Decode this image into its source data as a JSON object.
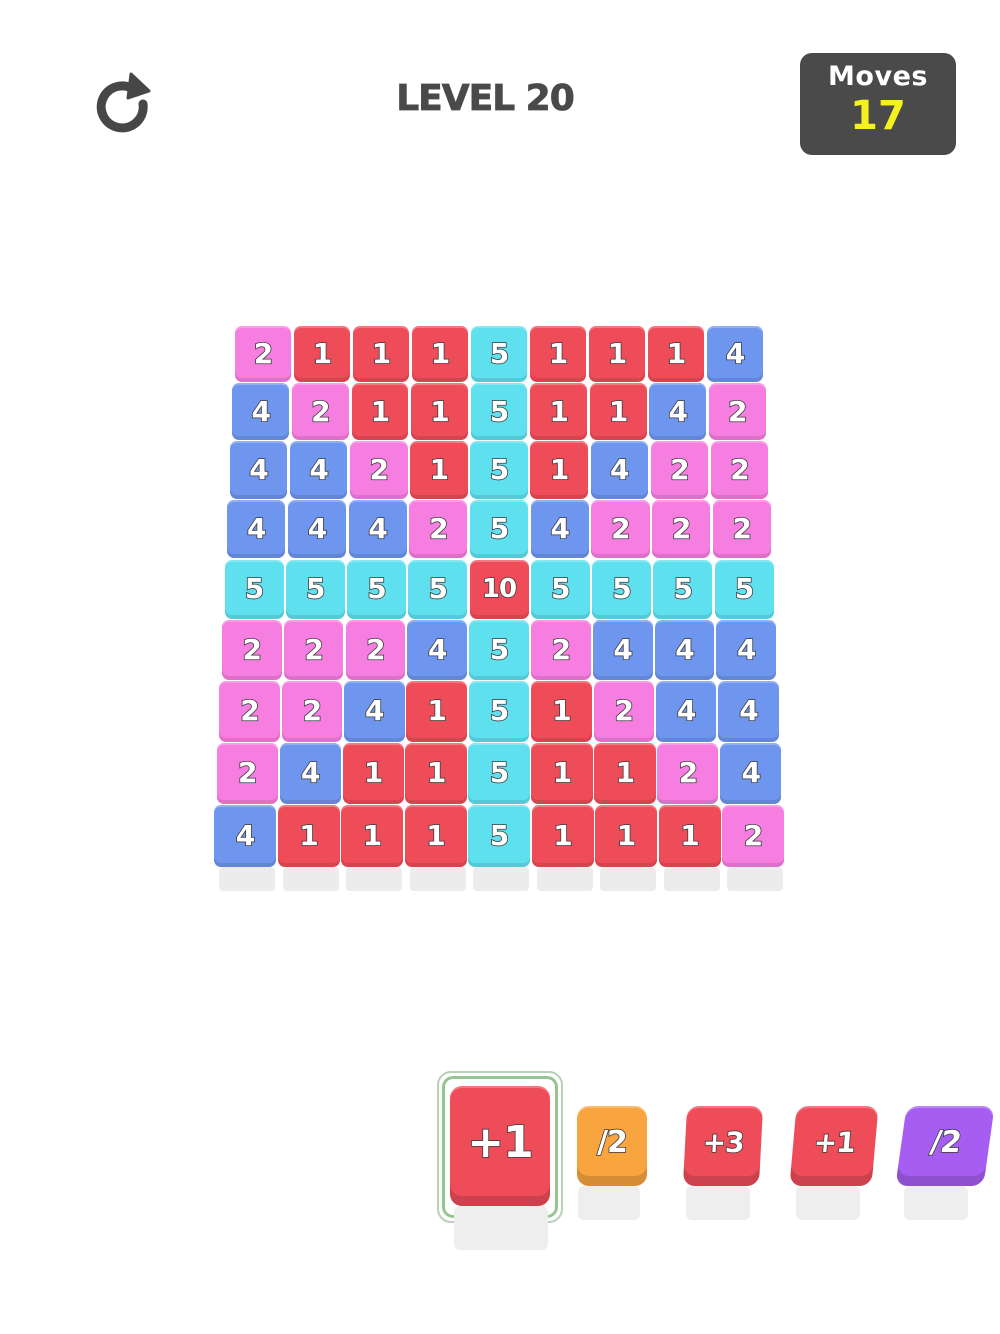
{
  "header": {
    "restart_icon": "restart-icon",
    "level_label": "LEVEL 20",
    "moves_label": "Moves",
    "moves_value": "17"
  },
  "colors": {
    "red": "#ef4c5a",
    "pink": "#f67ee0",
    "blue": "#6f96ee",
    "cyan": "#5fe0ef",
    "orange": "#f8a53f",
    "purple": "#a65ef2",
    "moves_bg": "#4a4a4a",
    "moves_value": "#f4f11f"
  },
  "board": {
    "rows": [
      [
        "2",
        "1",
        "1",
        "1",
        "5",
        "1",
        "1",
        "1",
        "4"
      ],
      [
        "4",
        "2",
        "1",
        "1",
        "5",
        "1",
        "1",
        "4",
        "2"
      ],
      [
        "4",
        "4",
        "2",
        "1",
        "5",
        "1",
        "4",
        "2",
        "2"
      ],
      [
        "4",
        "4",
        "4",
        "2",
        "5",
        "4",
        "2",
        "2",
        "2"
      ],
      [
        "5",
        "5",
        "5",
        "5",
        "10",
        "5",
        "5",
        "5",
        "5"
      ],
      [
        "2",
        "2",
        "2",
        "4",
        "5",
        "2",
        "4",
        "4",
        "4"
      ],
      [
        "2",
        "2",
        "4",
        "1",
        "5",
        "1",
        "2",
        "4",
        "4"
      ],
      [
        "2",
        "4",
        "1",
        "1",
        "5",
        "1",
        "1",
        "2",
        "4"
      ],
      [
        "4",
        "1",
        "1",
        "1",
        "5",
        "1",
        "1",
        "1",
        "2"
      ]
    ],
    "tile_colors": [
      [
        "pink",
        "red",
        "red",
        "red",
        "cyan",
        "red",
        "red",
        "red",
        "blue"
      ],
      [
        "blue",
        "pink",
        "red",
        "red",
        "cyan",
        "red",
        "red",
        "blue",
        "pink"
      ],
      [
        "blue",
        "blue",
        "pink",
        "red",
        "cyan",
        "red",
        "blue",
        "pink",
        "pink"
      ],
      [
        "blue",
        "blue",
        "blue",
        "pink",
        "cyan",
        "blue",
        "pink",
        "pink",
        "pink"
      ],
      [
        "cyan",
        "cyan",
        "cyan",
        "cyan",
        "red",
        "cyan",
        "cyan",
        "cyan",
        "cyan"
      ],
      [
        "pink",
        "pink",
        "pink",
        "blue",
        "cyan",
        "pink",
        "blue",
        "blue",
        "blue"
      ],
      [
        "pink",
        "pink",
        "blue",
        "red",
        "cyan",
        "red",
        "pink",
        "blue",
        "blue"
      ],
      [
        "pink",
        "blue",
        "red",
        "red",
        "cyan",
        "red",
        "red",
        "pink",
        "blue"
      ],
      [
        "blue",
        "red",
        "red",
        "red",
        "cyan",
        "red",
        "red",
        "red",
        "pink"
      ]
    ]
  },
  "tray": {
    "pieces": [
      {
        "label": "+1",
        "color": "red",
        "selected": true
      },
      {
        "label": "/2",
        "color": "orange",
        "selected": false
      },
      {
        "label": "+3",
        "color": "red",
        "selected": false
      },
      {
        "label": "+1",
        "color": "red",
        "selected": false
      },
      {
        "label": "/2",
        "color": "purple",
        "selected": false
      }
    ]
  }
}
